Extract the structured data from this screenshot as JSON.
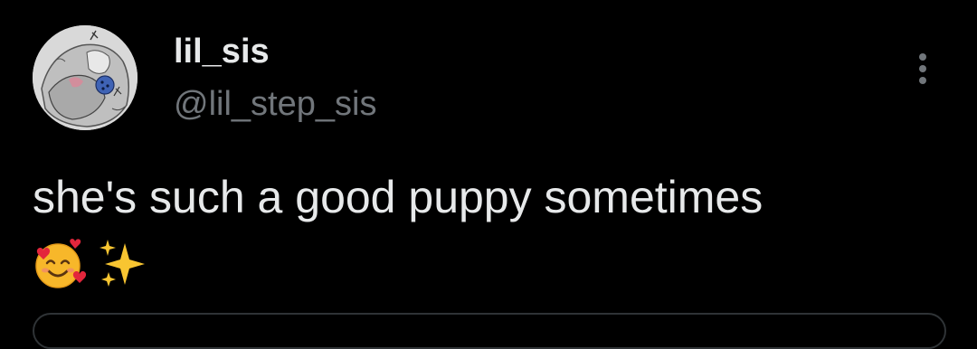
{
  "tweet": {
    "author": {
      "display_name": "lil_sis",
      "handle": "@lil_step_sis",
      "avatar_icon": "sketch-avatar"
    },
    "more_icon": "more-vertical-icon",
    "text": "she's such a good puppy sometimes",
    "emojis": [
      "smiling-face-with-hearts-emoji",
      "sparkles-emoji"
    ]
  },
  "colors": {
    "background": "#000000",
    "primary_text": "#e7e9ea",
    "secondary_text": "#71767b",
    "border": "#2f3336"
  }
}
